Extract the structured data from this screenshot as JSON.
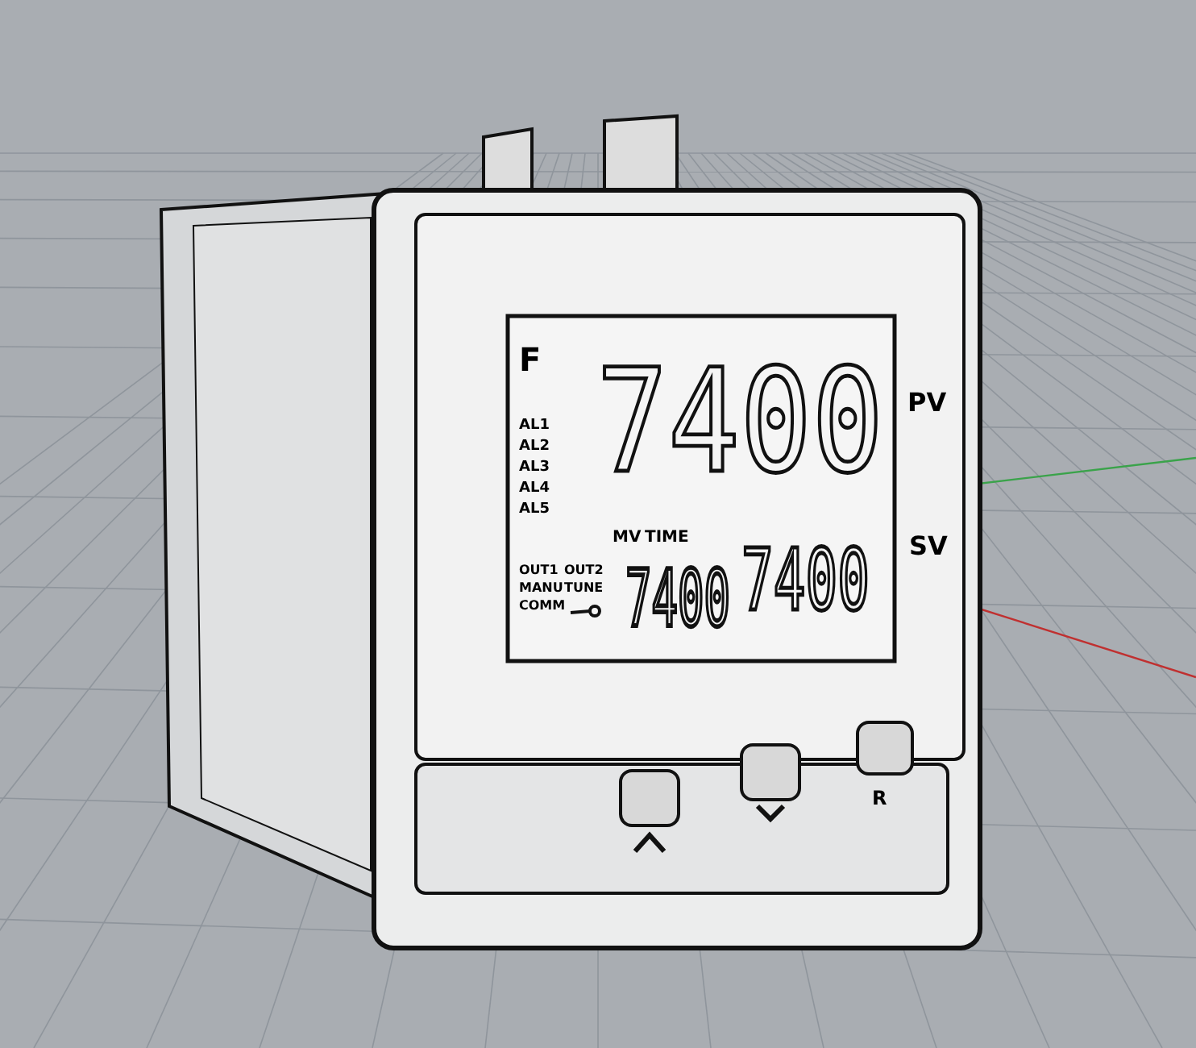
{
  "device": {
    "unit": "F",
    "pv_label": "PV",
    "sv_label": "SV",
    "pv_value": "7400",
    "sv_value": "7400",
    "mv_value": "7400",
    "mv_label": "MV",
    "time_label": "TIME",
    "alarms": [
      "AL1",
      "AL2",
      "AL3",
      "AL4",
      "AL5"
    ],
    "indicators": [
      "OUT1",
      "OUT2",
      "MANU",
      "TUNE",
      "COMM"
    ],
    "key_label": "R"
  }
}
